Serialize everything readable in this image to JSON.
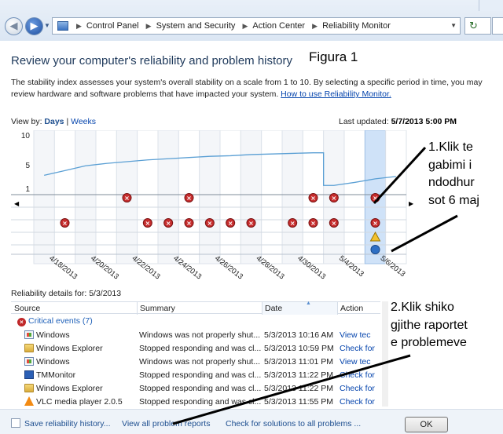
{
  "breadcrumbs": [
    "Control Panel",
    "System and Security",
    "Action Center",
    "Reliability Monitor"
  ],
  "title": "Review your computer's reliability and problem history",
  "annotation_figura": "Figura 1",
  "description": "The stability index assesses your system's overall stability on a scale from 1 to 10. By selecting a specific period in time, you may review hardware and software problems that have impacted your system. ",
  "description_link": "How to use Reliability Monitor.",
  "view_by": {
    "label": "View by:",
    "days": "Days",
    "sep": "|",
    "weeks": "Weeks"
  },
  "last_updated": {
    "label": "Last updated:",
    "value": "5/7/2013 5:00 PM"
  },
  "chart_data": {
    "type": "line",
    "y_ticks": [
      "10",
      "5",
      "1"
    ],
    "ylim": [
      1,
      10
    ],
    "x_labels": [
      "4/18/2013",
      "4/20/2013",
      "4/22/2013",
      "4/24/2013",
      "4/26/2013",
      "4/28/2013",
      "4/30/2013",
      "5/4/2013",
      "5/6/2013"
    ],
    "num_days": 18,
    "selected_day_index": 16,
    "stability_index": [
      3.2,
      4.0,
      4.8,
      5.2,
      5.5,
      5.8,
      6.0,
      6.2,
      6.4,
      6.5,
      6.7,
      6.8,
      6.9,
      7.0,
      1.5,
      2.0,
      2.6,
      3.0
    ],
    "critical_row1_days": [
      4,
      7,
      13,
      14,
      16
    ],
    "critical_row3_days": [
      1,
      5,
      6,
      7,
      8,
      9,
      10,
      12,
      13,
      14,
      16
    ],
    "warning_days": [
      16
    ],
    "info_days": [
      16
    ]
  },
  "annotation_1_lines": [
    "1.Klik te",
    "gabimi i",
    "ndodhur",
    "sot 6 maj"
  ],
  "details_label": "Reliability details for: 5/3/2013",
  "columns": {
    "source": "Source",
    "summary": "Summary",
    "date": "Date",
    "action": "Action"
  },
  "critical_group": "Critical events (7)",
  "rows": [
    {
      "icon": "windows-icon",
      "source": "Windows",
      "summary": "Windows was not properly shut...",
      "date": "5/3/2013 10:16 AM",
      "action": "View  tec"
    },
    {
      "icon": "folder-icon",
      "source": "Windows Explorer",
      "summary": "Stopped responding and was cl...",
      "date": "5/3/2013 10:59 PM",
      "action": "Check for"
    },
    {
      "icon": "windows-icon",
      "source": "Windows",
      "summary": "Windows was not properly shut...",
      "date": "5/3/2013 11:01 PM",
      "action": "View  tec"
    },
    {
      "icon": "tm-icon",
      "source": "TMMonitor",
      "summary": "Stopped responding and was cl...",
      "date": "5/3/2013 11:22 PM",
      "action": "Check for"
    },
    {
      "icon": "folder-icon",
      "source": "Windows Explorer",
      "summary": "Stopped responding and was cl...",
      "date": "5/3/2013 11:22 PM",
      "action": "Check for"
    },
    {
      "icon": "vlc-icon",
      "source": "VLC media player 2.0.5",
      "summary": "Stopped responding and was cl...",
      "date": "5/3/2013 11:55 PM",
      "action": "Check for"
    }
  ],
  "annotation_2_lines": [
    "2.Klik shiko",
    "gjithe raportet",
    "e problemeve"
  ],
  "footer": {
    "save_history": "Save reliability history...",
    "view_all": "View all problem reports",
    "check_solutions": "Check for solutions to all problems ...",
    "ok": "OK"
  }
}
